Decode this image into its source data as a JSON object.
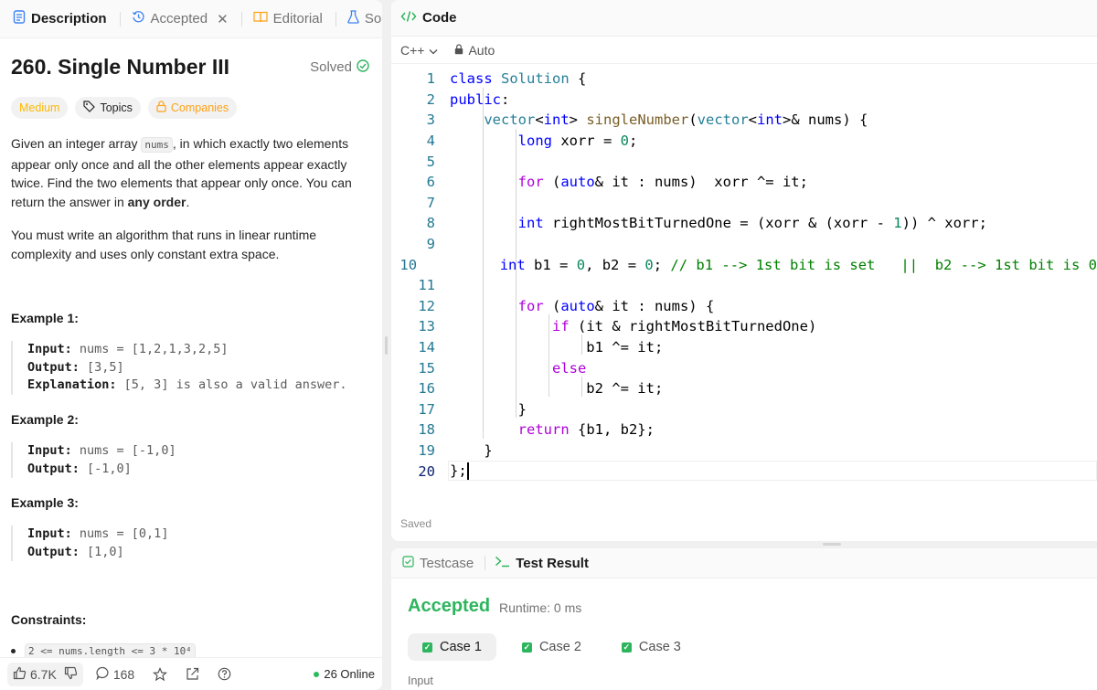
{
  "left_tabs": [
    {
      "label": "Description",
      "icon": "document-icon"
    },
    {
      "label": "Accepted",
      "icon": "history-icon"
    },
    {
      "label": "Editorial",
      "icon": "book-icon"
    },
    {
      "label": "Solutions",
      "icon": "flask-icon"
    }
  ],
  "problem": {
    "title": "260. Single Number III",
    "status": "Solved",
    "chips": [
      "Medium",
      "Topics",
      "Companies"
    ],
    "desc_parts": {
      "p1_a": "Given an integer array ",
      "p1_code": "nums",
      "p1_b": ", in which exactly two elements appear only once and all the other elements appear exactly twice. Find the two elements that appear only once. You can return the answer in ",
      "p1_bold": "any order",
      "p1_end": ".",
      "p2": "You must write an algorithm that runs in linear runtime complexity and uses only constant extra space."
    },
    "examples": [
      {
        "title": "Example 1:",
        "input_label": "Input:",
        "input": " nums = [1,2,1,3,2,5]",
        "output_label": "Output:",
        "output": " [3,5]",
        "expl_label": "Explanation:",
        "expl": "  [5, 3] is also a valid answer."
      },
      {
        "title": "Example 2:",
        "input_label": "Input:",
        "input": " nums = [-1,0]",
        "output_label": "Output:",
        "output": " [-1,0]"
      },
      {
        "title": "Example 3:",
        "input_label": "Input:",
        "input": " nums = [0,1]",
        "output_label": "Output:",
        "output": " [1,0]"
      }
    ],
    "constraints_title": "Constraints:",
    "constraint_1": "2 <= nums.length <= 3 * 10⁴"
  },
  "footer": {
    "likes": "6.7K",
    "comments": "168",
    "online": "26 Online"
  },
  "code_panel": {
    "title": "Code",
    "language": "C++",
    "mode": "Auto",
    "saved": "Saved",
    "line_numbers": [
      "1",
      "2",
      "3",
      "4",
      "5",
      "6",
      "7",
      "8",
      "9",
      "10",
      "11",
      "12",
      "13",
      "14",
      "15",
      "16",
      "17",
      "18",
      "19",
      "20"
    ]
  },
  "result_panel": {
    "tabs": [
      "Testcase",
      "Test Result"
    ],
    "status": "Accepted",
    "runtime": "Runtime: 0 ms",
    "cases": [
      "Case 1",
      "Case 2",
      "Case 3"
    ],
    "input_label": "Input"
  }
}
